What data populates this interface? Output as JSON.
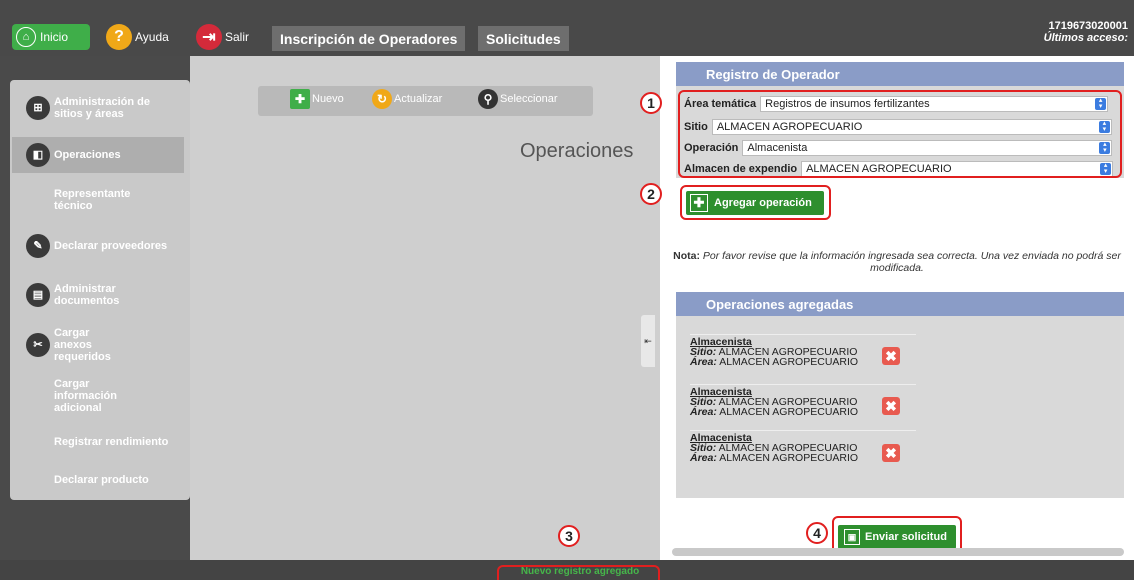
{
  "topbar": {
    "inicio_label": "Inicio",
    "ayuda_label": "Ayuda",
    "salir_label": "Salir",
    "tabs": [
      {
        "label": "Inscripción de Operadores"
      },
      {
        "label": "Solicitudes"
      }
    ],
    "user_id": "1719673020001",
    "last_access_label": "Últimos acceso:"
  },
  "sidebar": {
    "items": [
      {
        "label": "Administración de sitios y áreas",
        "icon": "sitemap-icon"
      },
      {
        "label": "Operaciones",
        "icon": "operations-icon"
      },
      {
        "label": "Representante técnico"
      },
      {
        "label": "Declarar proveedores",
        "icon": "provider-icon"
      },
      {
        "label": "Administrar documentos",
        "icon": "documents-icon"
      },
      {
        "label": "Cargar anexos requeridos",
        "icon": "paperclip-icon"
      },
      {
        "label": "Cargar información adicional"
      },
      {
        "label": "Registrar rendimiento"
      },
      {
        "label": "Declarar producto"
      }
    ]
  },
  "toolbar": {
    "nuevo_label": "Nuevo",
    "actualizar_label": "Actualizar",
    "seleccionar_label": "Seleccionar"
  },
  "main": {
    "title": "Operaciones"
  },
  "registro": {
    "header": "Registro de Operador",
    "area_label": "Área temática",
    "area_value": "Registros de insumos fertilizantes",
    "sitio_label": "Sitio",
    "sitio_value": "ALMACEN AGROPECUARIO",
    "operacion_label": "Operación",
    "operacion_value": "Almacenista",
    "almacen_label": "Almacen de expendio",
    "almacen_value": "ALMACEN AGROPECUARIO",
    "add_button_label": "Agregar operación"
  },
  "note": {
    "prefix": "Nota:",
    "text": "Por favor revise que la información ingresada sea correcta. Una vez enviada no podrá ser modificada."
  },
  "operaciones_agregadas": {
    "header": "Operaciones agregadas",
    "items": [
      {
        "title": "Almacenista",
        "sitio_label": "Sitio:",
        "sitio": "ALMACEN AGROPECUARIO",
        "area_label": "Área:",
        "area": "ALMACEN AGROPECUARIO"
      },
      {
        "title": "Almacenista",
        "sitio_label": "Sitio:",
        "sitio": "ALMACEN AGROPECUARIO",
        "area_label": "Área:",
        "area": "ALMACEN AGROPECUARIO"
      },
      {
        "title": "Almacenista",
        "sitio_label": "Sitio:",
        "sitio": "ALMACEN AGROPECUARIO",
        "area_label": "Área:",
        "area": "ALMACEN AGROPECUARIO"
      }
    ]
  },
  "send_button_label": "Enviar solicitud",
  "status_message": "Nuevo registro agregado",
  "annotations": [
    "1",
    "2",
    "3",
    "4"
  ],
  "colors": {
    "accent_green": "#2e8f2e",
    "header_blue": "#8a9cc7",
    "annotation_red": "#e11f1f",
    "status_green": "#46b64a"
  }
}
